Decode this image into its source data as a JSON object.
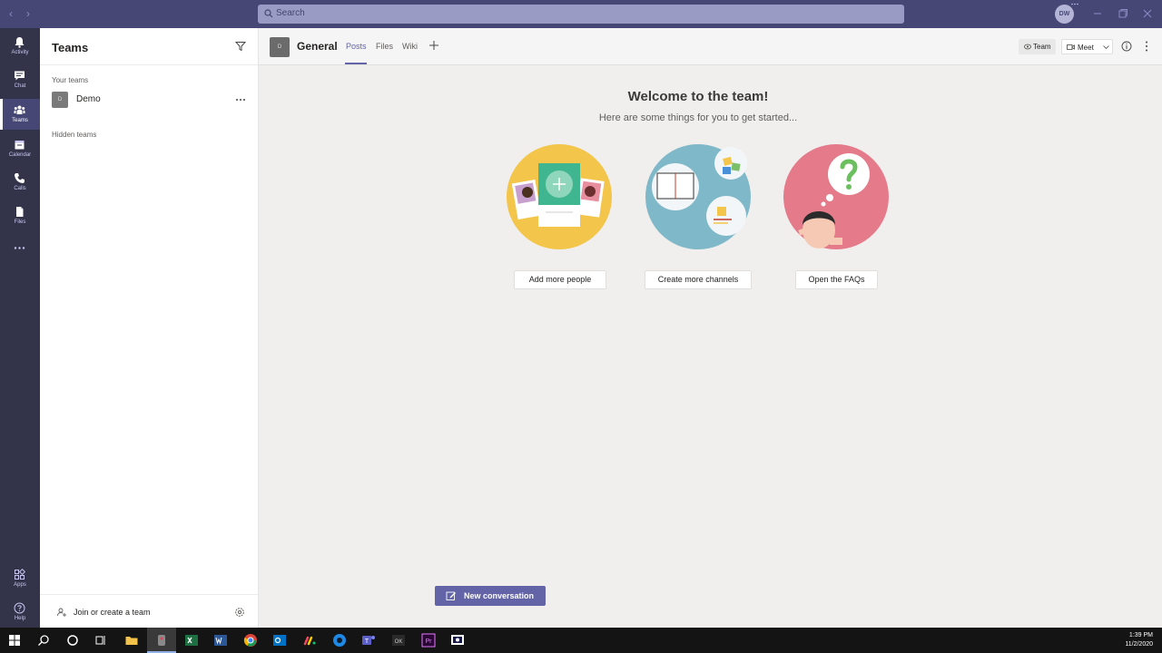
{
  "titlebar": {
    "search_placeholder": "Search",
    "avatar_initials": "DW"
  },
  "appbar": {
    "items": [
      {
        "label": "Activity",
        "icon": "bell-icon"
      },
      {
        "label": "Chat",
        "icon": "chat-icon"
      },
      {
        "label": "Teams",
        "icon": "teams-icon",
        "active": true
      },
      {
        "label": "Calendar",
        "icon": "calendar-icon"
      },
      {
        "label": "Calls",
        "icon": "phone-icon"
      },
      {
        "label": "Files",
        "icon": "file-icon"
      }
    ],
    "bottom_items": [
      {
        "label": "Apps",
        "icon": "apps-icon"
      },
      {
        "label": "Help",
        "icon": "help-icon"
      }
    ]
  },
  "teams_pane": {
    "title": "Teams",
    "your_teams_label": "Your teams",
    "teams": [
      {
        "tile_letter": "D",
        "name": "Demo"
      }
    ],
    "hidden_teams_label": "Hidden teams",
    "join_label": "Join or create a team"
  },
  "channel": {
    "tile_letter": "D",
    "name": "General",
    "tabs": [
      {
        "label": "Posts",
        "active": true
      },
      {
        "label": "Files"
      },
      {
        "label": "Wiki"
      }
    ],
    "team_button": "Team",
    "meet_button": "Meet"
  },
  "welcome": {
    "title": "Welcome to the team!",
    "subtitle": "Here are some things for you to get started...",
    "actions": [
      {
        "label": "Add more people",
        "illustration": "people-cards-illustration"
      },
      {
        "label": "Create more channels",
        "illustration": "channels-illustration"
      },
      {
        "label": "Open the FAQs",
        "illustration": "faq-question-illustration"
      }
    ],
    "new_conversation": "New conversation"
  },
  "taskbar": {
    "time": "1:39 PM",
    "date": "11/2/2020"
  },
  "colors": {
    "titlebar": "#464775",
    "appbar": "#33344a",
    "accent": "#6264a7"
  }
}
